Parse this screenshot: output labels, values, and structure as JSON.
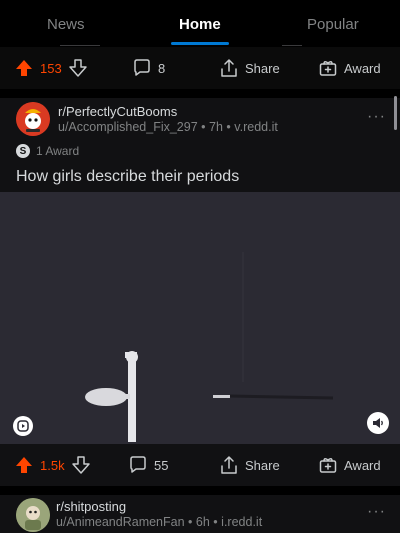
{
  "tabs": [
    {
      "label": "News",
      "active": false
    },
    {
      "label": "Home",
      "active": true
    },
    {
      "label": "Popular",
      "active": false
    }
  ],
  "top_actions": {
    "upvotes": "153",
    "comments": "8",
    "share_label": "Share",
    "award_label": "Award"
  },
  "post": {
    "subreddit": "r/PerfectlyCutBooms",
    "author": "u/Accomplished_Fix_297",
    "age": "7h",
    "domain": "v.redd.it",
    "awards": "1 Award",
    "title": "How girls describe their periods",
    "upvotes": "1.5k",
    "comments": "55",
    "share_label": "Share",
    "award_label": "Award"
  },
  "next_post": {
    "subreddit": "r/shitposting",
    "author": "u/AnimeandRamenFan",
    "age": "6h",
    "domain": "i.redd.it"
  },
  "more_label": "···",
  "meta_sep": "•",
  "colors": {
    "upvote": "#ff4500",
    "tab_active_underline": "#0079d3",
    "background": "#000000",
    "card": "#111113",
    "video_bg": "#2b2a33"
  }
}
